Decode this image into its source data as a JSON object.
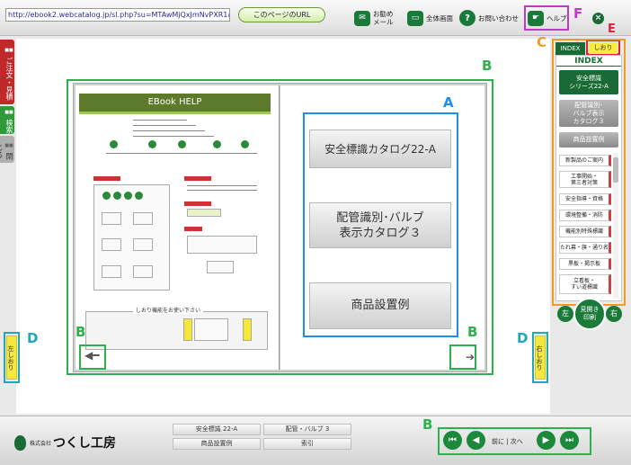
{
  "toolbar": {
    "url_value": "http://ebook2.webcatalog.jp/sl.php?su=MTAwMjQxJmNvPXR1a3V",
    "url_button": "このページのURL",
    "recommend_mail": "お勧め\nメール",
    "fullscreen": "全体画面",
    "contact": "お問い合わせ",
    "help": "ヘルプ",
    "close_icon": "×"
  },
  "side_tabs": {
    "order": "ご注文・見積",
    "search": "検索",
    "close": "閉じる"
  },
  "annotations": {
    "a": "A",
    "b": "B",
    "c": "C",
    "d": "D",
    "e": "E",
    "f": "F"
  },
  "left_page": {
    "header": "EBook HELP",
    "bookmark_section": "しおり機能をお使い下さい"
  },
  "right_page": {
    "buttons": [
      "安全標識カタログ22-A",
      "配管識別･バルブ\n表示カタログ３",
      "商品設置例"
    ]
  },
  "side_bookmarks": {
    "left": "左しおり",
    "right": "右しおり"
  },
  "index_panel": {
    "tab_index": "INDEX",
    "tab_shiori": "しおり",
    "title": "INDEX",
    "big_items": [
      "安全標識\nシリーズ22-A",
      "配管識別･\nバルブ表示\nカタログ３",
      "商品設置例"
    ],
    "small_items": [
      "新製品のご案内",
      "工事開始・\n第三者対策",
      "安全指導・資格",
      "環境整備・消防",
      "機能別特殊標識",
      "たれ幕・旗・通り名",
      "黒板・掲示板",
      "立看板・\nすい道標識"
    ]
  },
  "spread_nav": {
    "left": "左",
    "center": "見開き\n印刷",
    "right": "右"
  },
  "bottom": {
    "company_prefix": "株式会社",
    "company_name": "つくし工房",
    "links": [
      "安全標識 22-A",
      "配管・バルブ 3",
      "商品設置例",
      "索引"
    ],
    "nav_text": "前に | 次へ",
    "nav_first": "⏮",
    "nav_prev": "◀",
    "nav_next": "▶",
    "nav_last": "⏭"
  },
  "colors": {
    "brand_green": "#1a6a35",
    "annotation_green": "#2bb24c",
    "annotation_blue": "#1e8ee8",
    "annotation_orange": "#f09a28",
    "annotation_cyan": "#20a8b8",
    "annotation_red": "#e0203a",
    "annotation_purple": "#c038c8"
  }
}
